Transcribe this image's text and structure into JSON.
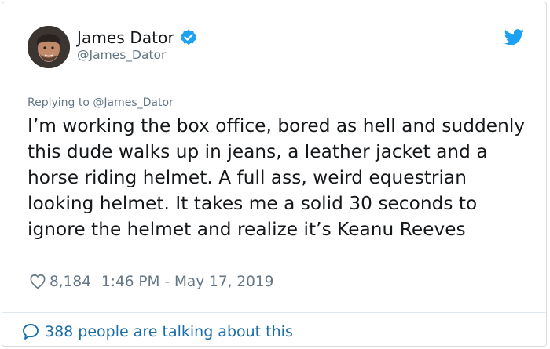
{
  "author": {
    "display_name": "James Dator",
    "handle": "@James_Dator",
    "verified_icon": "verified-badge-icon",
    "avatar_icon": "avatar"
  },
  "brand": {
    "logo_icon": "twitter-bird-icon",
    "color": "#1da1f2"
  },
  "tweet": {
    "reply_context": "Replying to @James_Dator",
    "text": "I’m working the box office, bored as hell and suddenly this dude walks up in jeans, a leather jacket and a horse riding helmet. A full ass, weird equestrian looking helmet. It takes me a solid 30 seconds to ignore the helmet and realize it’s Keanu Reeves",
    "likes": "8,184",
    "timestamp": "1:46 PM - May 17, 2019"
  },
  "footer": {
    "conversation_label": "388 people are talking about this",
    "icon": "speech-bubble-icon",
    "link_color": "#1b6ea8"
  },
  "colors": {
    "text": "#14171a",
    "muted": "#657786",
    "border": "#d7dbdf"
  }
}
